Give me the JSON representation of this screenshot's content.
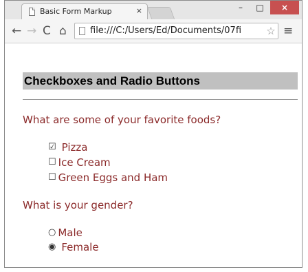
{
  "browser": {
    "tab_title": "Basic Form Markup",
    "tab_close": "×",
    "url": "file:///C:/Users/Ed/Documents/07fi",
    "controls": {
      "minimize": "–",
      "maximize": "□",
      "close": "×"
    },
    "nav": {
      "back": "←",
      "forward": "→",
      "reload": "C",
      "home": "⌂",
      "star": "☆",
      "menu": "≡"
    }
  },
  "page": {
    "heading": "Checkboxes and Radio Buttons",
    "food_question": "What are some of your favorite foods?",
    "foods": [
      {
        "label": "Pizza",
        "checked": true,
        "mark": "☑"
      },
      {
        "label": "Ice Cream",
        "checked": false,
        "mark": "☐"
      },
      {
        "label": "Green Eggs and Ham",
        "checked": false,
        "mark": "☐"
      }
    ],
    "gender_question": "What is your gender?",
    "genders": [
      {
        "label": "Male",
        "selected": false,
        "mark": "○"
      },
      {
        "label": "Female",
        "selected": true,
        "mark": "◉"
      }
    ]
  }
}
